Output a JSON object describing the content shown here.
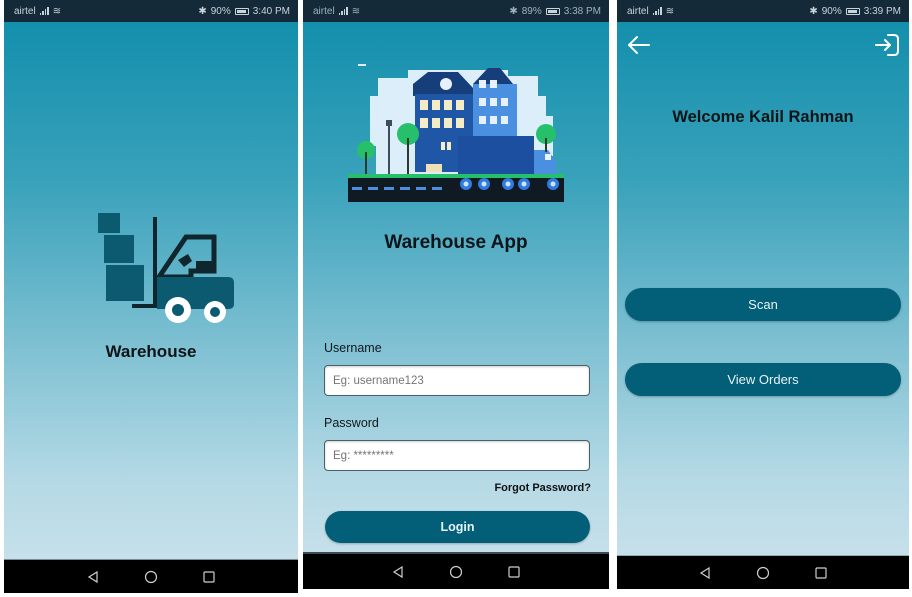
{
  "screens": [
    {
      "id": "splash",
      "status_bar": {
        "carrier": "airtel",
        "battery": "90%",
        "time": "3:40 PM"
      },
      "logo_icon": "forklift-icon",
      "title": "Warehouse"
    },
    {
      "id": "login",
      "status_bar": {
        "carrier": "airtel",
        "battery": "89%",
        "time": "3:38 PM"
      },
      "illustration_icon": "warehouse-street-illustration",
      "title": "Warehouse App",
      "username": {
        "label": "Username",
        "placeholder": "Eg: username123",
        "value": ""
      },
      "password": {
        "label": "Password",
        "placeholder": "Eg: *********",
        "value": ""
      },
      "forgot_password": "Forgot Password?",
      "login_button": "Login"
    },
    {
      "id": "home",
      "status_bar": {
        "carrier": "airtel",
        "battery": "90%",
        "time": "3:39 PM"
      },
      "back_icon": "arrow-left-icon",
      "logout_icon": "logout-icon",
      "welcome": "Welcome Kalil Rahman",
      "buttons": {
        "scan": "Scan",
        "view_orders": "View Orders"
      }
    }
  ],
  "nav_bar": {
    "icons": [
      "back-triangle-icon",
      "home-circle-icon",
      "recents-square-icon"
    ]
  },
  "colors": {
    "status_bar": "#152a38",
    "gradient_top": "#138fac",
    "gradient_bottom": "#c6e0ea",
    "button": "#035e78",
    "logo_primary": "#0b5a70"
  }
}
